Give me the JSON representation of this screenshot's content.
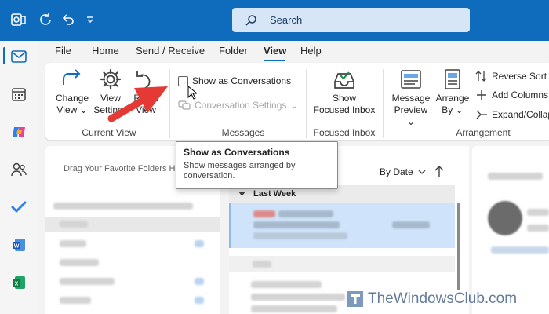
{
  "search": {
    "placeholder": "Search"
  },
  "menu": {
    "tabs": [
      "File",
      "Home",
      "Send / Receive",
      "Folder",
      "View",
      "Help"
    ],
    "active": "View"
  },
  "ribbon": {
    "current_view": {
      "change_view_line1": "Change",
      "change_view_line2": "View",
      "view_settings_line1": "View",
      "view_settings_line2": "Settings",
      "reset_view_line1": "Reset",
      "reset_view_line2": "View",
      "label": "Current View"
    },
    "messages": {
      "show_as_conversations": "Show as Conversations",
      "conversation_settings": "Conversation Settings",
      "label": "Messages"
    },
    "focused_inbox": {
      "button_line1": "Show",
      "button_line2": "Focused Inbox",
      "label": "Focused Inbox"
    },
    "arrangement": {
      "message_preview_line1": "Message",
      "message_preview_line2": "Preview",
      "arrange_by_line1": "Arrange",
      "arrange_by_line2": "By",
      "reverse_sort": "Reverse Sort",
      "add_columns": "Add Columns",
      "expand_collapse": "Expand/Collapse",
      "label": "Arrangement"
    }
  },
  "tooltip": {
    "title": "Show as Conversations",
    "description": "Show messages arranged by conversation."
  },
  "folder_pane": {
    "drag_hint": "Drag Your Favorite Folders Here"
  },
  "mail_list": {
    "sort_label": "By Date",
    "group_header": "Last Week"
  },
  "watermark": {
    "text": "TheWindowsClub.com"
  },
  "colors": {
    "accent": "#0f6cbd",
    "selection": "#cfe4fa",
    "arrow": "#e53935"
  }
}
